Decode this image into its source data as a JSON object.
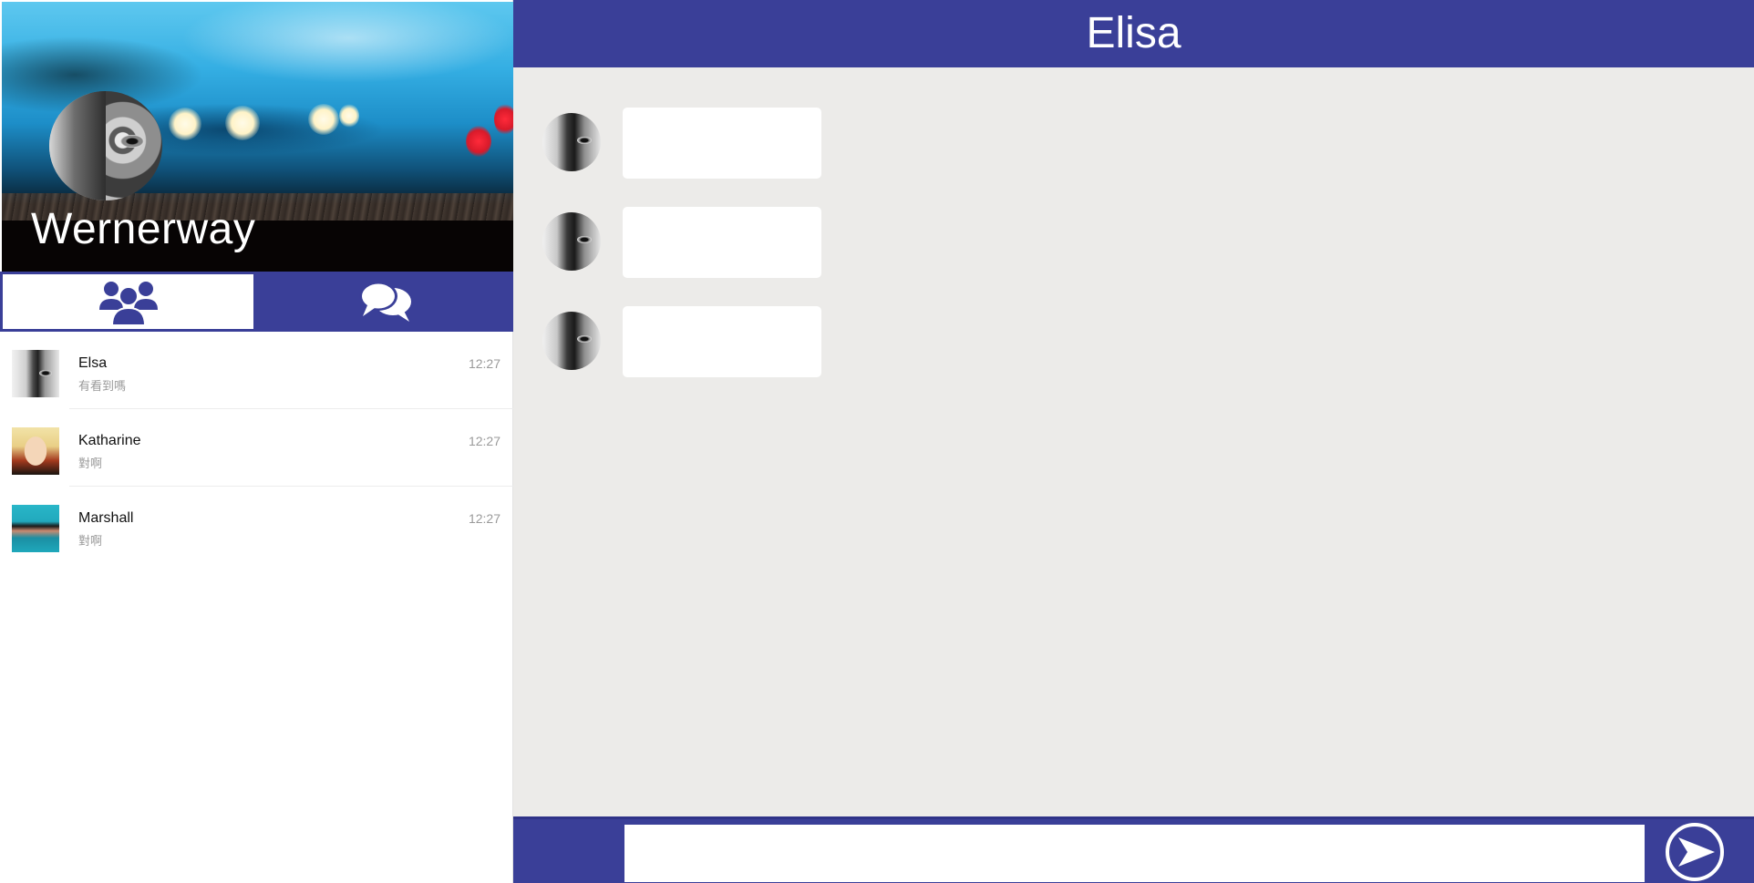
{
  "profile": {
    "name": "Wernerway"
  },
  "tabs": [
    {
      "icon": "users-icon",
      "active": true
    },
    {
      "icon": "chat-bubbles-icon",
      "active": false
    }
  ],
  "contacts": [
    {
      "name": "Elsa",
      "preview": "有看到嗎",
      "time": "12:27"
    },
    {
      "name": "Katharine",
      "preview": "對啊",
      "time": "12:27"
    },
    {
      "name": "Marshall",
      "preview": "對啊",
      "time": "12:27"
    }
  ],
  "chat": {
    "title": "Elisa",
    "messages": [
      {
        "text": ""
      },
      {
        "text": ""
      },
      {
        "text": ""
      }
    ]
  },
  "composer": {
    "input_value": "",
    "send_icon": "send-icon"
  },
  "colors": {
    "primary": "#3a3f98",
    "chat_background": "#ecebe9",
    "bubble": "#ffffff"
  }
}
